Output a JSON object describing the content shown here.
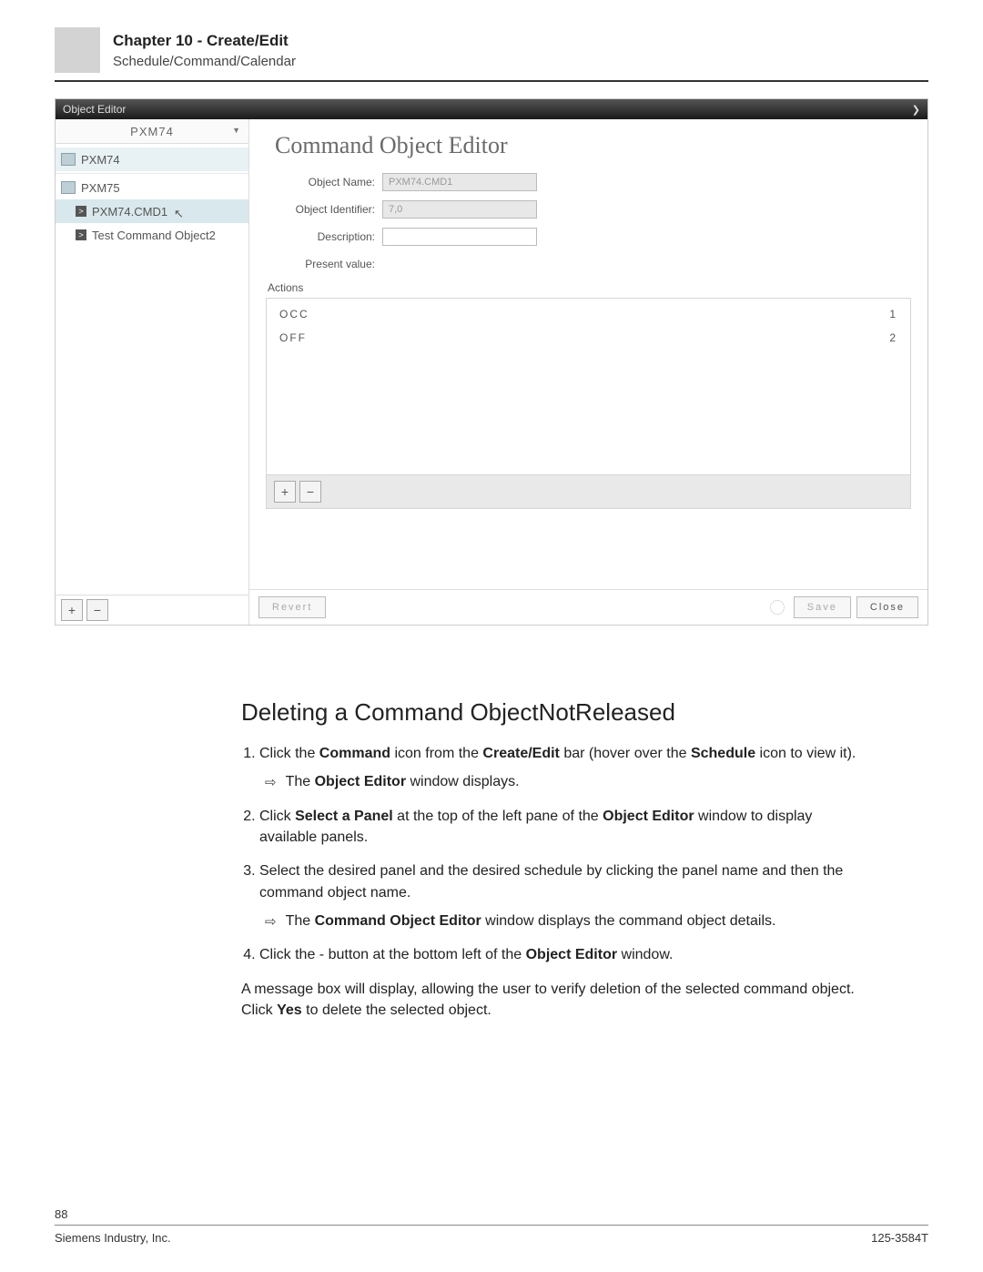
{
  "header": {
    "chapter_title": "Chapter 10 - Create/Edit",
    "chapter_sub": "Schedule/Command/Calendar"
  },
  "editor_window": {
    "titlebar": "Object Editor",
    "panel_selected": "PXM74",
    "tree": {
      "node_pxm74": "PXM74",
      "node_pxm75": "PXM75",
      "node_cmd1": "PXM74.CMD1",
      "node_cmd2": "Test Command Object2"
    },
    "right": {
      "heading": "Command Object Editor",
      "labels": {
        "object_name": "Object Name:",
        "object_identifier": "Object Identifier:",
        "description": "Description:",
        "present_value": "Present value:",
        "actions": "Actions"
      },
      "values": {
        "object_name": "PXM74.CMD1",
        "object_identifier": "7,0",
        "description": ""
      },
      "actions": [
        {
          "name": "OCC",
          "order": "1"
        },
        {
          "name": "OFF",
          "order": "2"
        }
      ],
      "buttons": {
        "revert": "Revert",
        "save": "Save",
        "close": "Close",
        "plus": "+",
        "minus": "−"
      }
    }
  },
  "doc_body": {
    "section_title": "Deleting a Command ObjectNotReleased",
    "steps": {
      "s1_a": "Click the ",
      "s1_b_bold": "Command",
      "s1_c": " icon from the ",
      "s1_d_bold": "Create/Edit",
      "s1_e": " bar (hover over the ",
      "s1_f_bold": "Schedule",
      "s1_g": " icon to view it).",
      "s1_result_a": "The ",
      "s1_result_b_bold": "Object Editor",
      "s1_result_c": " window displays.",
      "s2_a": "Click ",
      "s2_b_bold": "Select a Panel",
      "s2_c": " at the top of the left pane of the ",
      "s2_d_bold": "Object Editor",
      "s2_e": " window to display available panels.",
      "s3": "Select the desired panel and the desired schedule by clicking the panel name and then the command object name.",
      "s3_result_a": "The ",
      "s3_result_b_bold": "Command Object Editor",
      "s3_result_c": " window displays the command object details.",
      "s4_a": "Click the - button at the bottom left of the ",
      "s4_b_bold": "Object Editor",
      "s4_c": " window.",
      "final_a": "A message box will display, allowing the user to verify deletion of the selected command object. Click ",
      "final_b_bold": "Yes",
      "final_c": " to delete the selected object."
    }
  },
  "footer": {
    "page_num": "88",
    "left": "Siemens Industry, Inc.",
    "right": "125-3584T"
  }
}
